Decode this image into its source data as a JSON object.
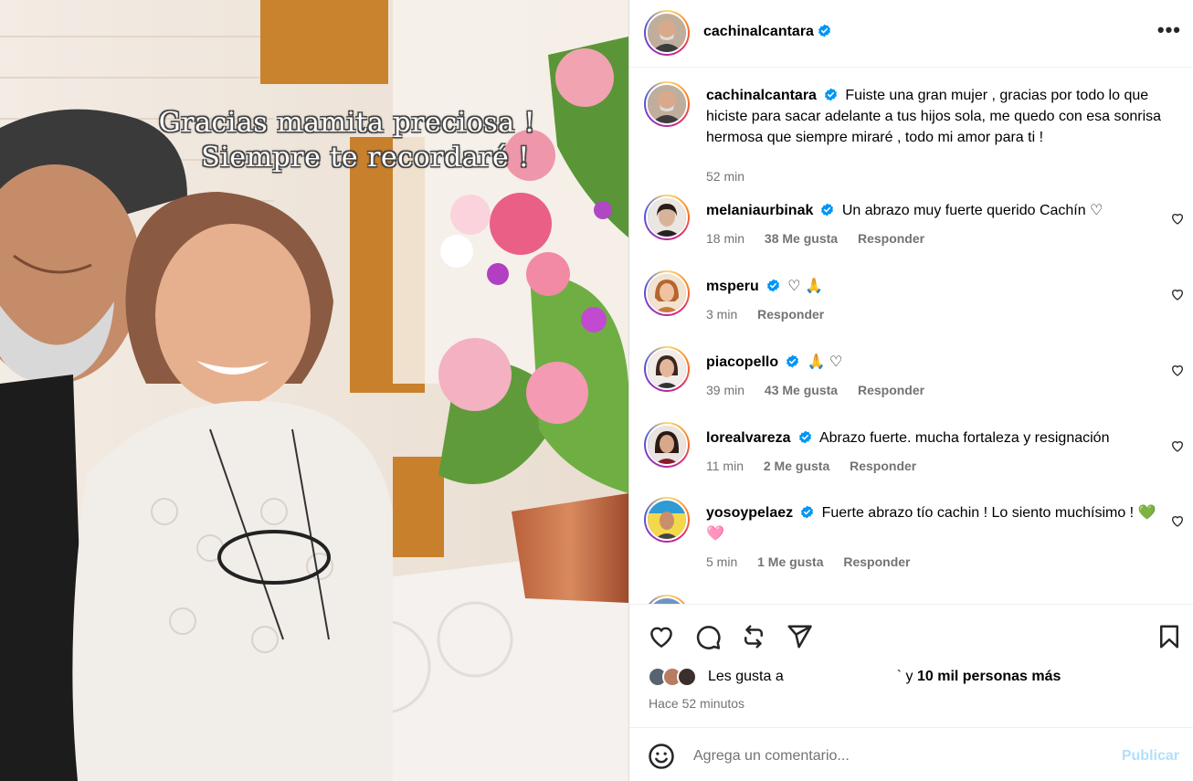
{
  "photo": {
    "caption_line1": "Gracias mamita preciosa !",
    "caption_line2": "Siempre te recordaré  !"
  },
  "header": {
    "username": "cachinalcantara",
    "more_label": "•••"
  },
  "caption_post": {
    "username": "cachinalcantara",
    "text": "Fuiste una gran mujer , gracias por todo lo que hiciste para sacar adelante a tus hijos sola, me quedo con esa sonrisa hermosa que siempre miraré , todo mi amor para ti !",
    "time": "52 min"
  },
  "comments": [
    {
      "username": "melaniaurbinak",
      "text": "Un abrazo muy fuerte querido Cachín ♡",
      "time": "18 min",
      "likes": "38 Me gusta",
      "reply": "Responder"
    },
    {
      "username": "msperu",
      "text": "♡ 🙏",
      "time": "3 min",
      "likes": "",
      "reply": "Responder"
    },
    {
      "username": "piacopello",
      "text": "🙏 ♡",
      "time": "39 min",
      "likes": "43 Me gusta",
      "reply": "Responder"
    },
    {
      "username": "lorealvareza",
      "text": "Abrazo fuerte. mucha fortaleza y resignación",
      "time": "11 min",
      "likes": "2 Me gusta",
      "reply": "Responder"
    },
    {
      "username": "yosoypelaez",
      "text": "Fuerte abrazo tío cachin ! Lo siento muchísimo ! 💚🩷",
      "time": "5 min",
      "likes": "1 Me gusta",
      "reply": "Responder"
    }
  ],
  "likes": {
    "prefix": "Les gusta a",
    "suffix_sep": "` y",
    "count": "10 mil personas más",
    "time_ago": "Hace 52 minutos"
  },
  "compose": {
    "placeholder": "Agrega un comentario...",
    "publish": "Publicar"
  },
  "colors": {
    "verified": "#0095f6",
    "muted": "#737373",
    "publish_disabled": "#b2dffc"
  }
}
